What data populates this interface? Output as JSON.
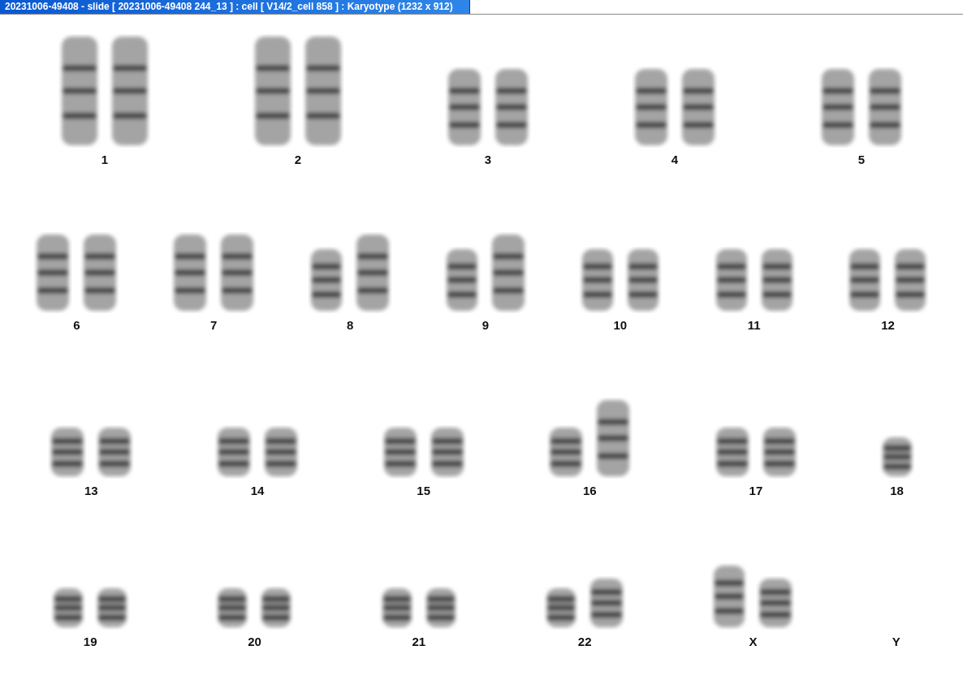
{
  "window": {
    "title": "20231006-49408 - slide [ 20231006-49408 244_13 ] : cell [ V14/2_cell 858 ] : Karyotype  (1232 x 912)"
  },
  "karyotype": {
    "rows": [
      {
        "groups": [
          {
            "label": "1",
            "chromosomes": [
              {
                "kind": "xl"
              },
              {
                "kind": "xl"
              }
            ]
          },
          {
            "label": "2",
            "chromosomes": [
              {
                "kind": "xl"
              },
              {
                "kind": "xl"
              }
            ]
          },
          {
            "label": "3",
            "chromosomes": [
              {
                "kind": "large"
              },
              {
                "kind": "large"
              }
            ]
          },
          {
            "label": "4",
            "chromosomes": [
              {
                "kind": "large"
              },
              {
                "kind": "large"
              }
            ]
          },
          {
            "label": "5",
            "chromosomes": [
              {
                "kind": "large"
              },
              {
                "kind": "large"
              }
            ]
          }
        ]
      },
      {
        "groups": [
          {
            "label": "6",
            "chromosomes": [
              {
                "kind": "large"
              },
              {
                "kind": "large"
              }
            ]
          },
          {
            "label": "7",
            "chromosomes": [
              {
                "kind": "large"
              },
              {
                "kind": "large"
              }
            ]
          },
          {
            "label": "8",
            "chromosomes": [
              {
                "kind": "medium"
              },
              {
                "kind": "large"
              }
            ]
          },
          {
            "label": "9",
            "chromosomes": [
              {
                "kind": "medium"
              },
              {
                "kind": "large"
              }
            ]
          },
          {
            "label": "10",
            "chromosomes": [
              {
                "kind": "medium"
              },
              {
                "kind": "medium"
              }
            ]
          },
          {
            "label": "11",
            "chromosomes": [
              {
                "kind": "medium"
              },
              {
                "kind": "medium"
              }
            ]
          },
          {
            "label": "12",
            "chromosomes": [
              {
                "kind": "medium"
              },
              {
                "kind": "medium"
              }
            ]
          }
        ]
      },
      {
        "groups": [
          {
            "label": "13",
            "chromosomes": [
              {
                "kind": "small"
              },
              {
                "kind": "small"
              }
            ]
          },
          {
            "label": "14",
            "chromosomes": [
              {
                "kind": "small"
              },
              {
                "kind": "small"
              }
            ]
          },
          {
            "label": "15",
            "chromosomes": [
              {
                "kind": "small"
              },
              {
                "kind": "small"
              }
            ]
          },
          {
            "label": "16",
            "chromosomes": [
              {
                "kind": "small"
              },
              {
                "kind": "large"
              }
            ]
          },
          {
            "label": "17",
            "chromosomes": [
              {
                "kind": "small"
              },
              {
                "kind": "small"
              }
            ]
          },
          {
            "label": "18",
            "chromosomes": [
              {
                "kind": "tiny"
              }
            ]
          }
        ]
      },
      {
        "groups": [
          {
            "label": "19",
            "chromosomes": [
              {
                "kind": "tiny"
              },
              {
                "kind": "tiny"
              }
            ]
          },
          {
            "label": "20",
            "chromosomes": [
              {
                "kind": "tiny"
              },
              {
                "kind": "tiny"
              }
            ]
          },
          {
            "label": "21",
            "chromosomes": [
              {
                "kind": "tiny"
              },
              {
                "kind": "tiny"
              }
            ]
          },
          {
            "label": "22",
            "chromosomes": [
              {
                "kind": "tiny"
              },
              {
                "kind": "small"
              }
            ]
          },
          {
            "label": "X",
            "chromosomes": [
              {
                "kind": "medium"
              },
              {
                "kind": "small"
              }
            ]
          },
          {
            "label": "Y"
          }
        ]
      }
    ]
  }
}
